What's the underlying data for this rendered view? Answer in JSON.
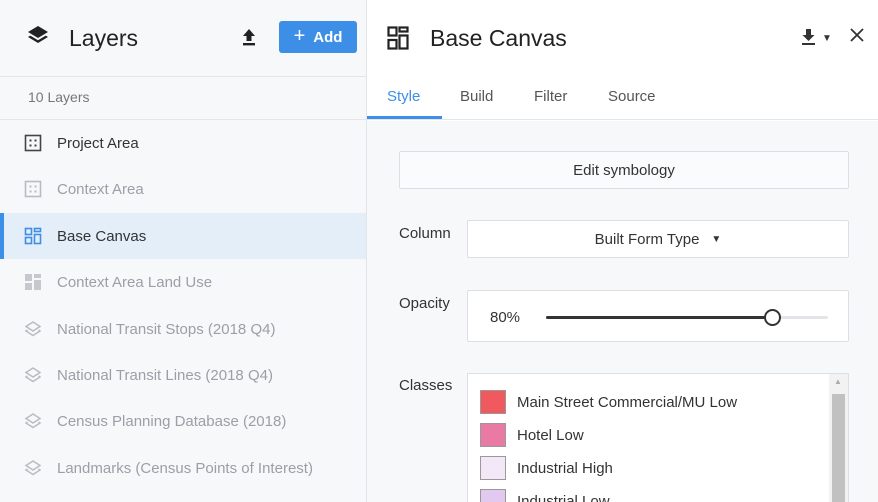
{
  "layers_panel": {
    "title": "Layers",
    "add_label": "Add",
    "layer_count": "10 Layers",
    "items": [
      {
        "label": "Project Area",
        "icon": "grid-area-icon",
        "state": "active"
      },
      {
        "label": "Context Area",
        "icon": "grid-area-icon",
        "state": "dim"
      },
      {
        "label": "Base Canvas",
        "icon": "canvas-grid-icon",
        "state": "selected"
      },
      {
        "label": "Context Area Land Use",
        "icon": "tiles-icon",
        "state": "dim"
      },
      {
        "label": "National Transit Stops (2018 Q4)",
        "icon": "stack-icon",
        "state": "dim"
      },
      {
        "label": "National Transit Lines (2018 Q4)",
        "icon": "stack-icon",
        "state": "dim"
      },
      {
        "label": "Census Planning Database (2018)",
        "icon": "stack-icon",
        "state": "dim"
      },
      {
        "label": "Landmarks (Census Points of Interest)",
        "icon": "stack-icon",
        "state": "dim"
      }
    ]
  },
  "detail_panel": {
    "title": "Base Canvas",
    "tabs": [
      {
        "label": "Style",
        "active": true
      },
      {
        "label": "Build",
        "active": false
      },
      {
        "label": "Filter",
        "active": false
      },
      {
        "label": "Source",
        "active": false
      }
    ],
    "edit_symbology_label": "Edit symbology",
    "column_label": "Column",
    "column_value": "Built Form Type",
    "opacity_label": "Opacity",
    "opacity_value": "80%",
    "opacity_fraction": 0.8,
    "classes_label": "Classes",
    "classes": [
      {
        "name": "Main Street Commercial/MU Low",
        "color": "#f05a5f"
      },
      {
        "name": "Hotel Low",
        "color": "#e97aa4"
      },
      {
        "name": "Industrial High",
        "color": "#f3e8f8"
      },
      {
        "name": "Industrial Low",
        "color": "#e2c9f0"
      }
    ]
  },
  "colors": {
    "accent": "#3d8ee6",
    "selected_row_bg": "#e4eef9",
    "dim_text": "#9aa0a6"
  }
}
